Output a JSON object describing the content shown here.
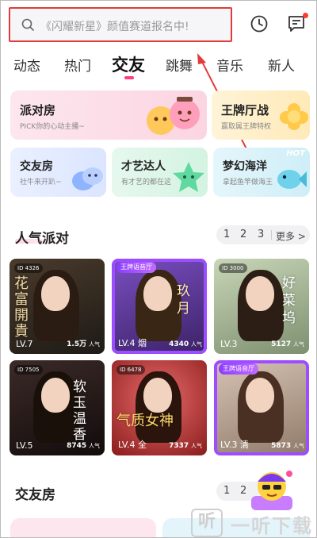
{
  "search": {
    "placeholder": "《闪耀新星》颜值赛道报名中!"
  },
  "tabs": [
    {
      "label": "动态"
    },
    {
      "label": "热门"
    },
    {
      "label": "交友",
      "active": true
    },
    {
      "label": "跳舞"
    },
    {
      "label": "音乐"
    },
    {
      "label": "新人"
    }
  ],
  "categories": {
    "party": {
      "title": "派对房",
      "subtitle": "PICK你的心动主播~"
    },
    "king": {
      "title": "王牌厅战",
      "subtitle": "赢取属王牌特权"
    },
    "friend": {
      "title": "交友房",
      "subtitle": "社牛来开趴~"
    },
    "talent": {
      "title": "才艺达人",
      "subtitle": "有才艺的都在这"
    },
    "ocean": {
      "title": "梦幻海洋",
      "subtitle": "拿起鱼竿做海王",
      "tag": "HOT"
    }
  },
  "section1": {
    "title": "人气派对",
    "pages": [
      "1",
      "2",
      "3"
    ],
    "more": "更多 >"
  },
  "rooms": [
    {
      "id_tag": "ID 4326",
      "level": "LV.7",
      "pop": "1.5万",
      "pop_unit": "人气",
      "callig": "花 富 開 貴"
    },
    {
      "badge": "王牌语音厅",
      "level": "LV.4 烟",
      "pop": "4340",
      "pop_unit": "人气",
      "callig": "玖 月"
    },
    {
      "id_tag": "ID 3000",
      "level": "LV.3",
      "pop": "5127",
      "pop_unit": "人气",
      "callig": "好 菜 坞"
    },
    {
      "id_tag": "ID 7505",
      "level": "LV.5",
      "pop": "8745",
      "pop_unit": "人气",
      "callig": "软 玉 温 香"
    },
    {
      "id_tag": "ID 6478",
      "level": "LV.4 全",
      "pop": "7337",
      "pop_unit": "人气",
      "callig": "气质女神"
    },
    {
      "badge": "王牌语音厅",
      "level": "LV.3 清",
      "pop": "5873",
      "pop_unit": "人气",
      "callig": ""
    }
  ],
  "section2": {
    "title": "交友房",
    "pages": [
      "1",
      "2"
    ]
  },
  "watermark": {
    "icon": "听",
    "text": "一听下载"
  },
  "colors": {
    "accent": "#ff3b82",
    "highlight": "#e23b3b",
    "king": "#9b4dff"
  }
}
